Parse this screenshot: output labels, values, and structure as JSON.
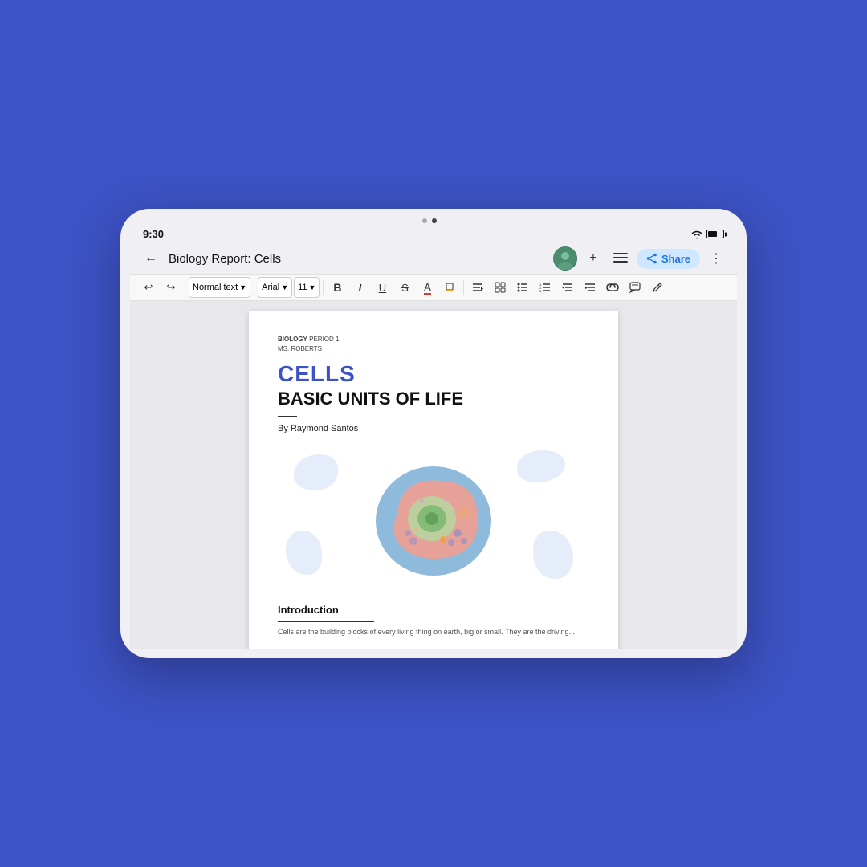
{
  "background": "#3d52c4",
  "tablet": {
    "status_bar": {
      "time": "9:30",
      "wifi_bars": 3,
      "battery_level": 60
    },
    "app_bar": {
      "back_label": "←",
      "title": "Biology Report: Cells",
      "actions": {
        "add_label": "+",
        "account_label": "≡",
        "share_label": "Share",
        "more_label": "⋮"
      }
    },
    "toolbar": {
      "undo_label": "↩",
      "redo_label": "↪",
      "style_label": "Normal text",
      "font_label": "Arial",
      "size_label": "11",
      "bold_label": "B",
      "italic_label": "I",
      "underline_label": "U",
      "strikethrough_label": "S",
      "text_color_label": "A",
      "highlight_label": "🖊",
      "align_label": "≡",
      "more1_label": "⊞",
      "bullet_label": "≡",
      "number_label": "≡",
      "indent_dec_label": "⇤",
      "indent_inc_label": "⇥",
      "link_label": "🔗",
      "comment_label": "⌨",
      "pen_label": "✏"
    },
    "document": {
      "meta_bold": "BIOLOGY",
      "meta_rest": " PERIOD 1",
      "meta_line2": "MS. ROBERTS",
      "title_cells": "CELLS",
      "subtitle": "BASIC UNITS OF LIFE",
      "author": "By Raymond Santos",
      "intro_heading": "Introduction",
      "intro_text": "Cells are the building blocks of every living thing on earth, big or small. They are the driving..."
    }
  }
}
